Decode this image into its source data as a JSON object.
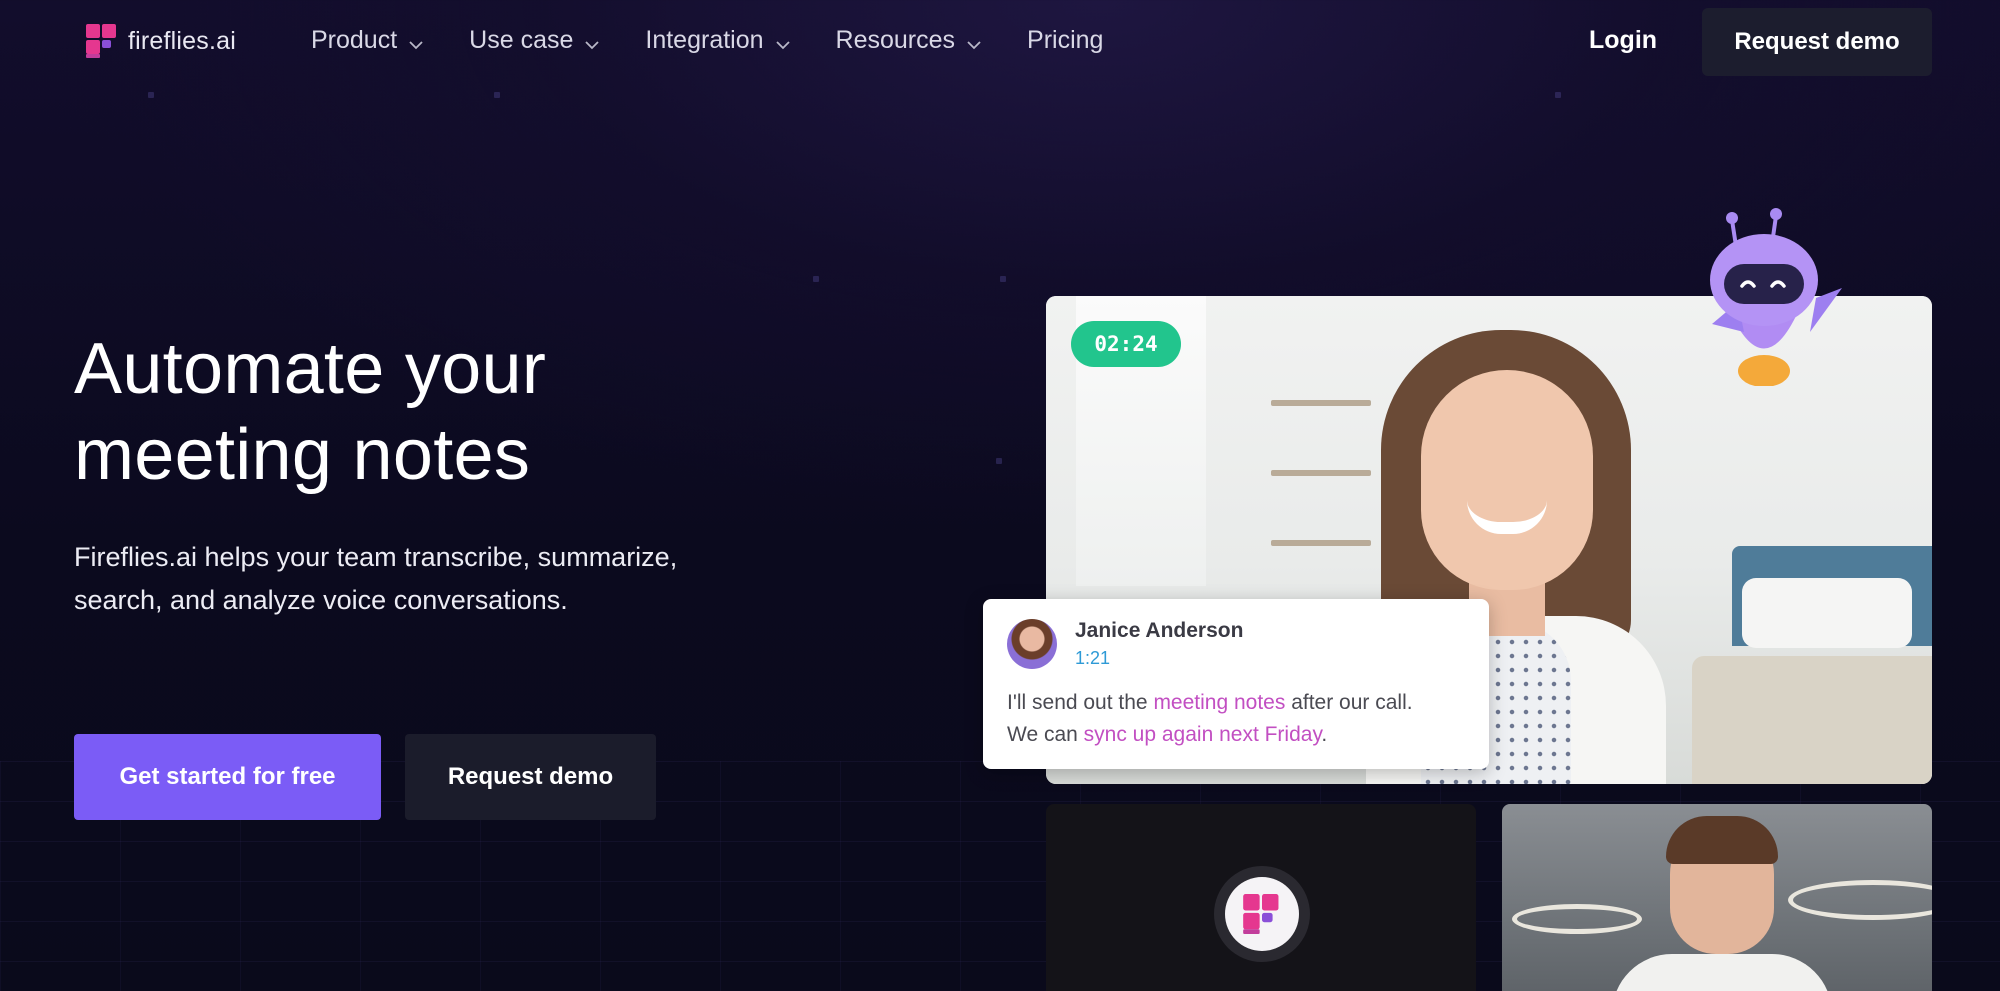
{
  "brand": {
    "name": "fireflies.ai",
    "primary_color": "#7b5cf6",
    "accent_pink": "#e5378f"
  },
  "nav": {
    "items": [
      {
        "label": "Product",
        "has_dropdown": true
      },
      {
        "label": "Use case",
        "has_dropdown": true
      },
      {
        "label": "Integration",
        "has_dropdown": true
      },
      {
        "label": "Resources",
        "has_dropdown": true
      },
      {
        "label": "Pricing",
        "has_dropdown": false
      }
    ],
    "login_label": "Login",
    "demo_label": "Request demo"
  },
  "hero": {
    "headline_line1": "Automate your",
    "headline_line2": "meeting notes",
    "subtext_line1": "Fireflies.ai helps your team transcribe, summarize,",
    "subtext_line2": "search, and analyze voice conversations.",
    "cta_primary": "Get started for free",
    "cta_secondary": "Request demo"
  },
  "video": {
    "timer": "02:24",
    "timer_color": "#22c58d"
  },
  "transcript": {
    "speaker": "Janice Anderson",
    "timestamp": "1:21",
    "text_part1": "I'll send out the ",
    "highlight1": "meeting notes",
    "text_part2": " after our call.",
    "text_part3": "We can ",
    "highlight2": "sync up again next Friday",
    "text_part4": "."
  },
  "icons": {
    "logo": "fireflies-logo-icon",
    "dropdown": "chevron-down-icon",
    "mascot": "robot-mascot-icon"
  }
}
